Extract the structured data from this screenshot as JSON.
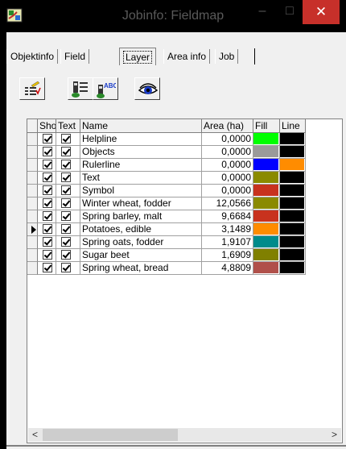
{
  "window": {
    "title": "Jobinfo: Fieldmap",
    "minimize_glyph": "–",
    "maximize_glyph": "□",
    "close_glyph": "✕",
    "app_icon": "map-app-icon"
  },
  "tabs": [
    {
      "label": "Objektinfo",
      "active": false
    },
    {
      "label": "Field",
      "active": false
    },
    {
      "label": "Layer",
      "active": true
    },
    {
      "label": "Area info",
      "active": false
    },
    {
      "label": "Job",
      "active": false
    }
  ],
  "toolbar": {
    "buttons": [
      {
        "icon": "edit-list-icon"
      },
      {
        "icon": "layer-properties-icon"
      },
      {
        "icon": "layer-text-icon"
      },
      {
        "icon": "eye-view-icon"
      }
    ],
    "text_icon_label": "ABC"
  },
  "grid": {
    "columns": [
      "Sho",
      "Text",
      "Name",
      "Area (ha)",
      "Fill",
      "Line"
    ],
    "rows": [
      {
        "show": true,
        "text": true,
        "name": "Helpline",
        "area": "0,0000",
        "fill": "#00ff00",
        "line": "#000000",
        "current": false
      },
      {
        "show": true,
        "text": true,
        "name": "Objects",
        "area": "0,0000",
        "fill": "#9a9a9a",
        "line": "#000000",
        "current": false
      },
      {
        "show": true,
        "text": true,
        "name": "Rulerline",
        "area": "0,0000",
        "fill": "#0000ff",
        "line": "#ff8c00",
        "current": false
      },
      {
        "show": true,
        "text": true,
        "name": "Text",
        "area": "0,0000",
        "fill": "#8a8a00",
        "line": "#000000",
        "current": false
      },
      {
        "show": true,
        "text": true,
        "name": "Symbol",
        "area": "0,0000",
        "fill": "#c8321e",
        "line": "#000000",
        "current": false
      },
      {
        "show": true,
        "text": true,
        "name": "Winter wheat, fodder",
        "area": "12,0566",
        "fill": "#8a8a00",
        "line": "#000000",
        "current": false
      },
      {
        "show": true,
        "text": true,
        "name": "Spring barley, malt",
        "area": "9,6684",
        "fill": "#c8321e",
        "line": "#000000",
        "current": false
      },
      {
        "show": true,
        "text": true,
        "name": "Potatoes, edible",
        "area": "3,1489",
        "fill": "#ff8c00",
        "line": "#000000",
        "current": true
      },
      {
        "show": true,
        "text": true,
        "name": "Spring oats, fodder",
        "area": "1,9107",
        "fill": "#008b8b",
        "line": "#000000",
        "current": false
      },
      {
        "show": true,
        "text": true,
        "name": "Sugar beet",
        "area": "1,6909",
        "fill": "#808000",
        "line": "#000000",
        "current": false
      },
      {
        "show": true,
        "text": true,
        "name": "Spring wheat, bread",
        "area": "4,8809",
        "fill": "#b0504a",
        "line": "#000000",
        "current": false
      }
    ]
  },
  "scrollbar": {
    "left_glyph": "<",
    "right_glyph": ">"
  }
}
